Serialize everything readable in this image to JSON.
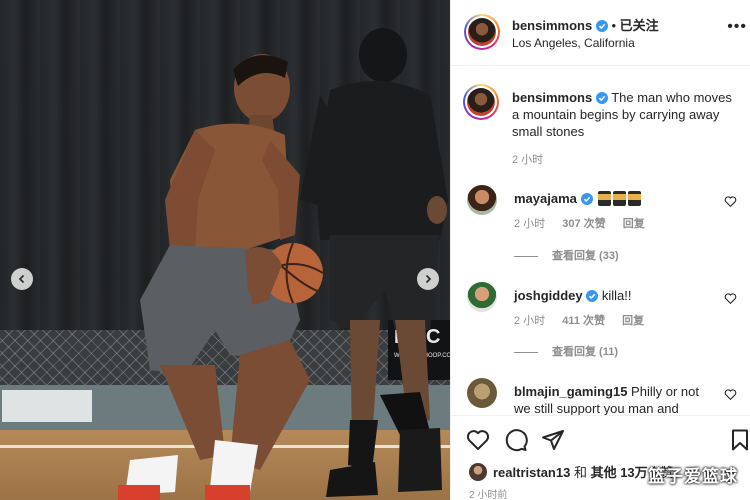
{
  "header": {
    "username": "bensimmons",
    "separator": "•",
    "follow_label": "已关注",
    "location": "Los Angeles, California",
    "more_label": "•••"
  },
  "caption": {
    "username": "bensimmons",
    "text": "The man who moves a mountain begins by carrying away small stones",
    "time": "2 小时"
  },
  "photo": {
    "sign_text": "ROC",
    "sign_sub": "WWW.JUSHOOP.CO"
  },
  "comments": [
    {
      "username": "mayajama",
      "text": "",
      "emoji": [
        "family-emoji",
        "family-emoji",
        "family-emoji"
      ],
      "time": "2 小时",
      "likes": "307 次赞",
      "reply": "回复",
      "view_replies": "查看回复 (33)"
    },
    {
      "username": "joshgiddey",
      "text": "killa!!",
      "time": "2 小时",
      "likes": "411 次赞",
      "reply": "回复",
      "view_replies": "查看回复 (11)"
    },
    {
      "username": "blmajin_gaming15",
      "text": "Philly or not we still support you man and"
    }
  ],
  "likes_line": {
    "user": "realtristan13",
    "and": "和",
    "others": "其他 13万",
    "suffix": "个赞"
  },
  "post_time": "2 小时前",
  "watermark": "篮子爱篮球",
  "colors": {
    "verified": "#3897f0",
    "secondary_text": "#8e8e8e",
    "primary_text": "#262626"
  }
}
